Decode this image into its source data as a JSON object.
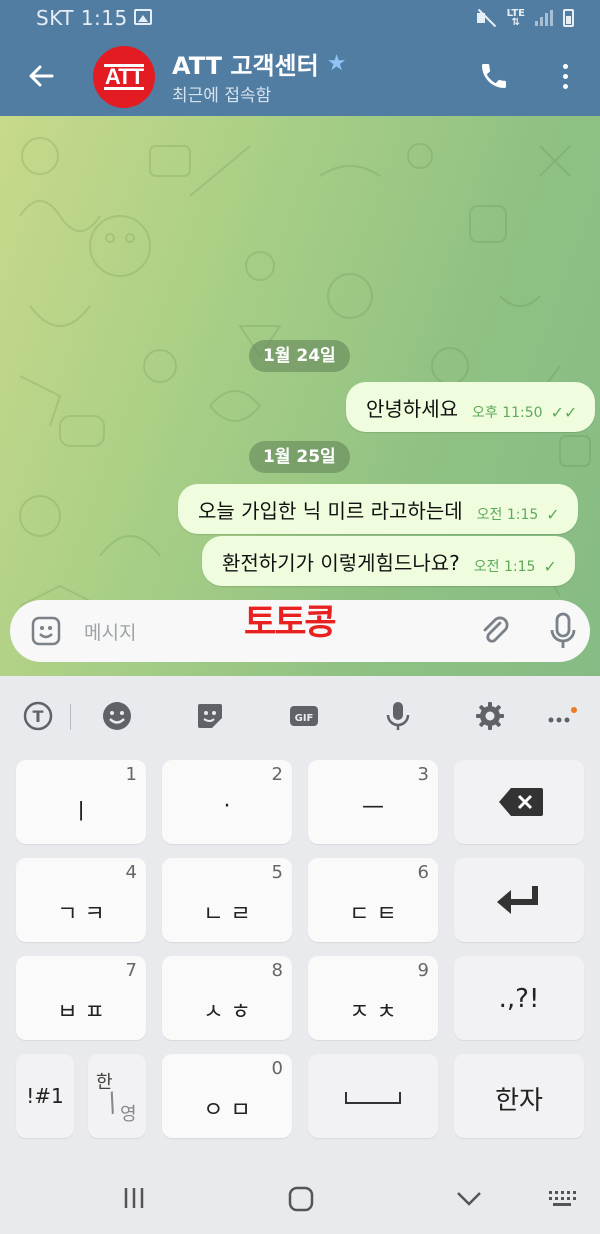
{
  "status_bar": {
    "carrier_time": "SKT 1:15",
    "network": "LTE"
  },
  "header": {
    "back_icon": "arrow-left-icon",
    "avatar_text": "ATT",
    "title": "ATT 고객센터",
    "title_star": "★",
    "subtitle": "최근에 접속함",
    "call_icon": "phone-icon",
    "menu_icon": "more-vertical-icon"
  },
  "chat": {
    "date1": "1월 24일",
    "msg1": {
      "text": "안녕하세요",
      "time": "오후 11:50",
      "status": "✓✓"
    },
    "date2": "1월 25일",
    "msg2": {
      "text": "오늘 가입한 닉 미르 라고하는데",
      "time": "오전 1:15",
      "status": "✓"
    },
    "msg3": {
      "text": "환전하기가 이렇게힘드나요?",
      "time": "오전 1:15",
      "status": "✓"
    }
  },
  "composer": {
    "placeholder": "메시지"
  },
  "overlay_text": "토토콩",
  "keyboard": {
    "rows": [
      [
        {
          "label": "ㅣ",
          "num": "1"
        },
        {
          "label": "·",
          "num": "2"
        },
        {
          "label": "—",
          "num": "3"
        }
      ],
      [
        {
          "label": "ㄱ ㅋ",
          "num": "4"
        },
        {
          "label": "ㄴ ㄹ",
          "num": "5"
        },
        {
          "label": "ㄷ ㅌ",
          "num": "6"
        }
      ],
      [
        {
          "label": "ㅂ ㅍ",
          "num": "7"
        },
        {
          "label": "ㅅ ㅎ",
          "num": "8"
        },
        {
          "label": "ㅈ ㅊ",
          "num": "9"
        }
      ]
    ],
    "punct": ".,?!",
    "symbols": "!#1",
    "lang_top": "한",
    "lang_bottom": "영",
    "bottom_key": {
      "label": "ㅇ ㅁ",
      "num": "0"
    },
    "hanja": "한자",
    "space_symbol": "␣"
  },
  "colors": {
    "header": "#517da2",
    "bubble": "#effdde",
    "tick": "#5fa95a",
    "overlay": "#e8201f"
  }
}
